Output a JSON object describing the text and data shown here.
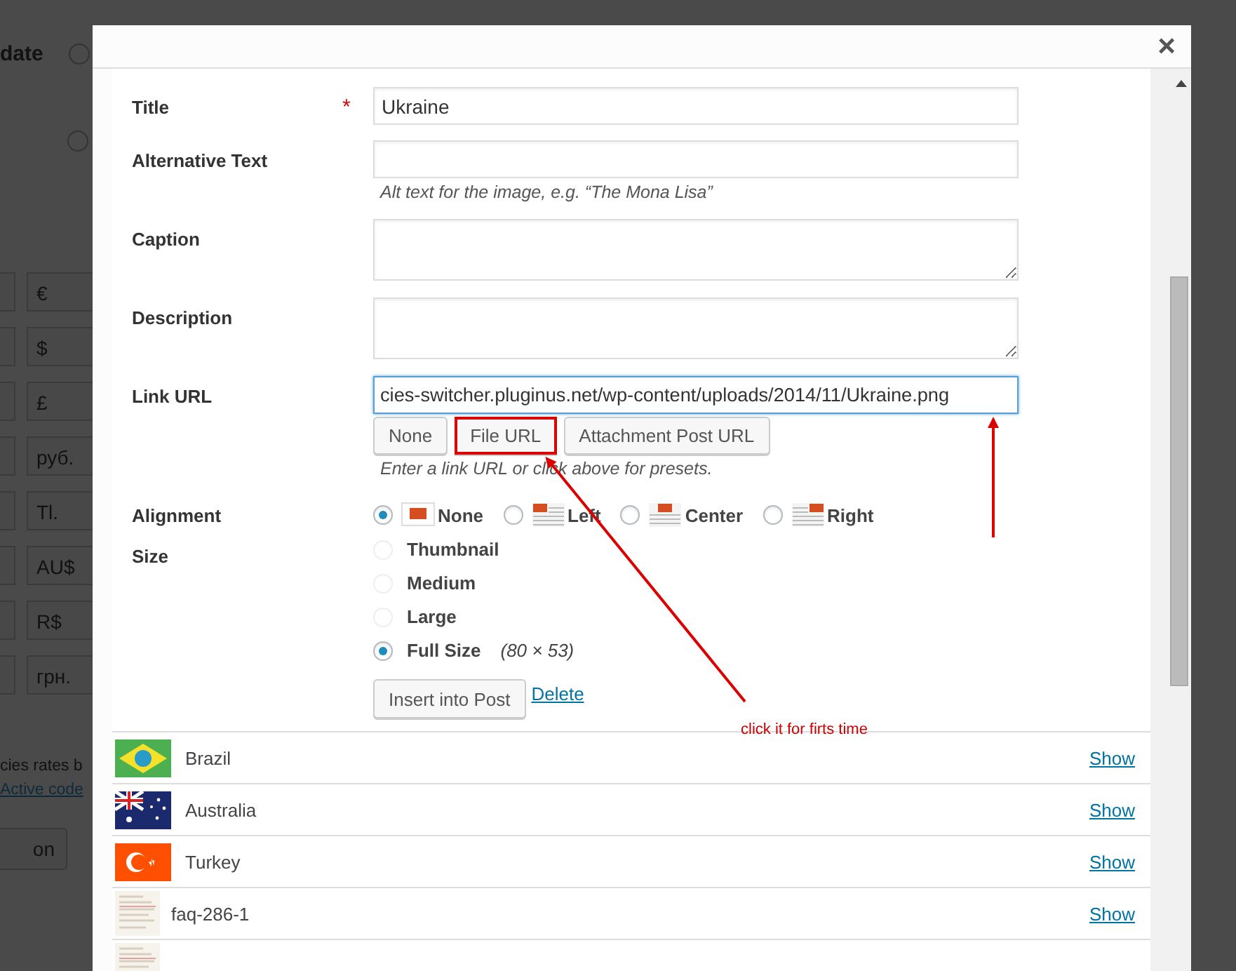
{
  "background_page": {
    "heading": "date",
    "currency_symbols": [
      "€",
      "$",
      "£",
      "руб.",
      "Tl.",
      "AU$",
      "R$",
      "грн."
    ],
    "note": "cies rates b",
    "link": "Active code",
    "button": "on"
  },
  "modal": {
    "close": "×",
    "fields": [
      {
        "kind": "text",
        "label": "Title",
        "required_mark": "*",
        "value": "Ukraine"
      },
      {
        "kind": "text",
        "label": "Alternative Text",
        "hint": "Alt text for the image, e.g. “The Mona Lisa”"
      },
      {
        "kind": "textarea",
        "label": "Caption"
      },
      {
        "kind": "textarea",
        "label": "Description"
      },
      {
        "kind": "url",
        "label": "Link URL",
        "value": "cies-switcher.pluginus.net/wp-content/uploads/2014/11/Ukraine.png",
        "buttons": [
          {
            "label": "None",
            "highlighted": false
          },
          {
            "label": "File URL",
            "highlighted": true
          },
          {
            "label": "Attachment Post URL",
            "highlighted": false
          }
        ],
        "hint": "Enter a link URL or click above for presets."
      }
    ],
    "alignment": {
      "label": "Alignment",
      "options": [
        {
          "label": "None",
          "kind": "none",
          "selected": true
        },
        {
          "label": "Left",
          "kind": "left",
          "selected": false
        },
        {
          "label": "Center",
          "kind": "center",
          "selected": false
        },
        {
          "label": "Right",
          "kind": "right",
          "selected": false
        }
      ]
    },
    "size": {
      "label": "Size",
      "options": [
        {
          "label": "Thumbnail",
          "selected": false,
          "disabled": true
        },
        {
          "label": "Medium",
          "selected": false,
          "disabled": true
        },
        {
          "label": "Large",
          "selected": false,
          "disabled": true
        },
        {
          "label": "Full Size",
          "selected": true,
          "disabled": false,
          "dimensions": "(80 × 53)"
        }
      ]
    },
    "insert_button": "Insert into Post",
    "delete_link": "Delete",
    "media_list": [
      {
        "kind": "brazil",
        "name": "Brazil",
        "action": "Show"
      },
      {
        "kind": "australia",
        "name": "Australia",
        "action": "Show"
      },
      {
        "kind": "turkey",
        "name": "Turkey",
        "action": "Show"
      },
      {
        "kind": "document",
        "name": "faq-286-1",
        "action": "Show"
      },
      {
        "kind": "document"
      }
    ]
  },
  "annotation": {
    "note": "click it for firts time"
  }
}
